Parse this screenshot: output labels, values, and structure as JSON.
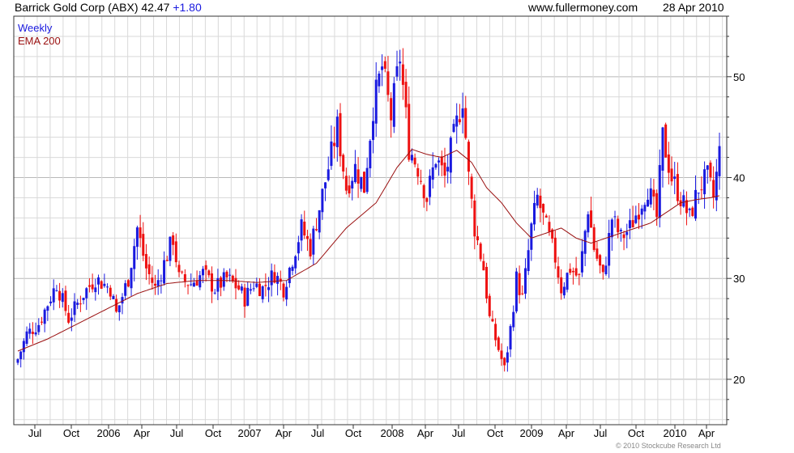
{
  "header": {
    "title": "Barrick Gold Corp (ABX)",
    "price": "42.47",
    "change": "+1.80",
    "site": "www.fullermoney.com",
    "date": "28 Apr 2010"
  },
  "legend": {
    "series1": "Weekly",
    "series2": "EMA 200"
  },
  "credit": "© 2010 Stockcube Research Ltd",
  "colors": {
    "up": "#1a1adf",
    "down": "#ee1111",
    "ema": "#9a1010",
    "grid": "#d9d9d9"
  },
  "chart_data": {
    "type": "candlestick",
    "ylim": [
      15.5,
      56
    ],
    "y_ticks": [
      20,
      30,
      40,
      50
    ],
    "x_tick_labels": [
      "Jul",
      "Oct",
      "2006",
      "Apr",
      "Jul",
      "Oct",
      "2007",
      "Apr",
      "Jul",
      "Oct",
      "2008",
      "Apr",
      "Jul",
      "Oct",
      "2009",
      "Apr",
      "Jul",
      "Oct",
      "2010",
      "Apr"
    ],
    "close_anchors": [
      [
        0,
        22
      ],
      [
        3,
        24.5
      ],
      [
        7,
        25.5
      ],
      [
        10,
        27.5
      ],
      [
        13,
        29.5
      ],
      [
        17,
        26
      ],
      [
        22,
        28.5
      ],
      [
        26,
        30
      ],
      [
        31,
        29
      ],
      [
        33,
        26.5
      ],
      [
        37,
        30
      ],
      [
        40,
        35
      ],
      [
        43,
        31
      ],
      [
        46,
        29
      ],
      [
        49,
        31.5
      ],
      [
        52,
        34
      ],
      [
        54,
        30
      ],
      [
        58,
        29.5
      ],
      [
        62,
        30.5
      ],
      [
        66,
        29
      ],
      [
        70,
        30
      ],
      [
        74,
        29
      ],
      [
        76,
        28
      ],
      [
        79,
        29.5
      ],
      [
        82,
        29
      ],
      [
        86,
        30.5
      ],
      [
        89,
        29
      ],
      [
        92,
        32
      ],
      [
        95,
        35
      ],
      [
        98,
        33
      ],
      [
        101,
        37
      ],
      [
        104,
        41
      ],
      [
        107,
        45
      ],
      [
        110,
        39
      ],
      [
        113,
        41
      ],
      [
        116,
        39
      ],
      [
        119,
        47
      ],
      [
        122,
        51
      ],
      [
        125,
        46
      ],
      [
        128,
        52
      ],
      [
        131,
        43
      ],
      [
        134,
        41
      ],
      [
        137,
        38
      ],
      [
        140,
        42
      ],
      [
        143,
        40
      ],
      [
        146,
        44
      ],
      [
        149,
        48
      ],
      [
        151,
        40
      ],
      [
        153,
        35
      ],
      [
        156,
        31
      ],
      [
        158,
        26
      ],
      [
        161,
        23
      ],
      [
        163,
        21
      ],
      [
        165,
        25
      ],
      [
        167,
        30
      ],
      [
        169,
        28
      ],
      [
        172,
        35
      ],
      [
        174,
        38
      ],
      [
        177,
        35
      ],
      [
        180,
        32
      ],
      [
        182,
        29
      ],
      [
        185,
        31
      ],
      [
        188,
        30
      ],
      [
        191,
        37
      ],
      [
        193,
        33
      ],
      [
        196,
        30
      ],
      [
        199,
        36
      ],
      [
        202,
        34
      ],
      [
        205,
        35
      ],
      [
        208,
        37
      ],
      [
        211,
        39
      ],
      [
        214,
        36
      ],
      [
        216,
        44
      ],
      [
        219,
        40
      ],
      [
        222,
        38
      ],
      [
        225,
        36
      ],
      [
        228,
        39
      ],
      [
        231,
        40
      ],
      [
        233,
        38
      ],
      [
        235,
        42.5
      ]
    ],
    "ema_anchors": [
      [
        0,
        22.8
      ],
      [
        10,
        24
      ],
      [
        20,
        25.5
      ],
      [
        30,
        27
      ],
      [
        40,
        28.5
      ],
      [
        50,
        29.5
      ],
      [
        60,
        29.8
      ],
      [
        70,
        29.8
      ],
      [
        80,
        29.6
      ],
      [
        90,
        29.8
      ],
      [
        100,
        31.5
      ],
      [
        110,
        35
      ],
      [
        120,
        37.5
      ],
      [
        127,
        41
      ],
      [
        132,
        42.8
      ],
      [
        137,
        42.3
      ],
      [
        142,
        42
      ],
      [
        147,
        42.7
      ],
      [
        152,
        41.5
      ],
      [
        157,
        39
      ],
      [
        162,
        37.5
      ],
      [
        167,
        35.5
      ],
      [
        172,
        34
      ],
      [
        177,
        34.5
      ],
      [
        182,
        35
      ],
      [
        187,
        34
      ],
      [
        192,
        33.5
      ],
      [
        197,
        34
      ],
      [
        202,
        34.5
      ],
      [
        207,
        35
      ],
      [
        212,
        35.5
      ],
      [
        217,
        36.5
      ],
      [
        222,
        37.5
      ],
      [
        227,
        37.8
      ],
      [
        232,
        38
      ],
      [
        235,
        38.2
      ]
    ]
  }
}
